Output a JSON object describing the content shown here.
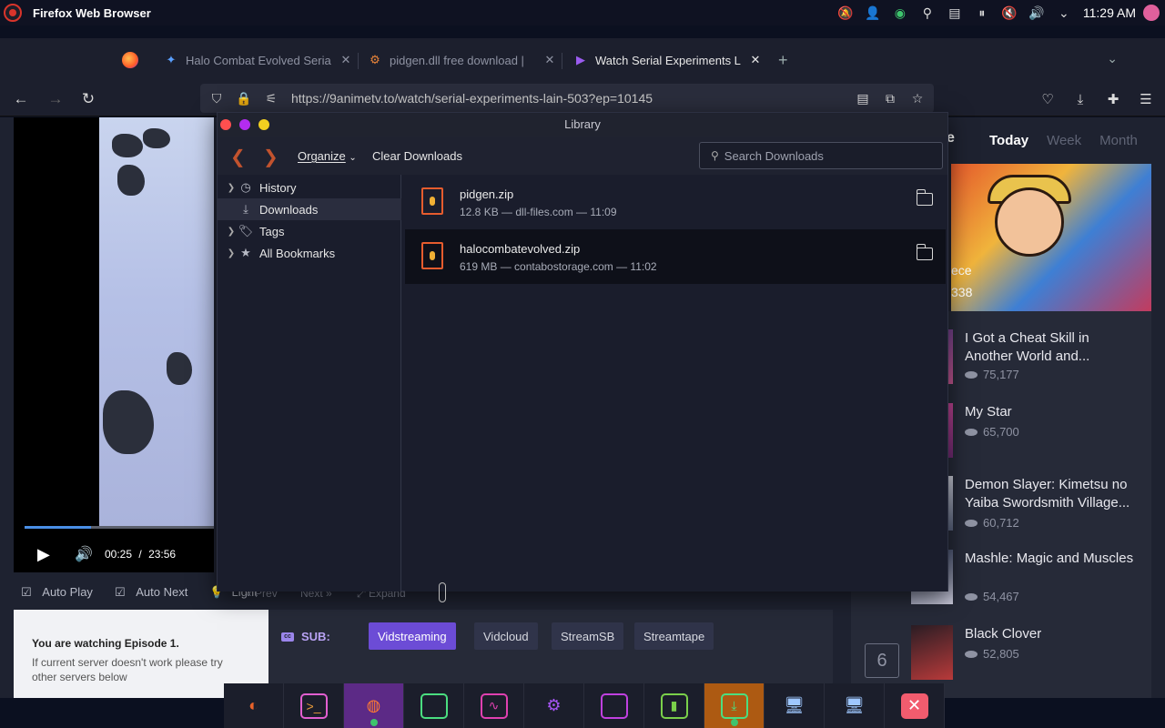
{
  "os_panel": {
    "app_title": "Firefox Web Browser",
    "clock": "11:29 AM"
  },
  "browser": {
    "tabs": [
      {
        "label": "Halo Combat Evolved Seria",
        "active": false
      },
      {
        "label": "pidgen.dll free download |",
        "active": false
      },
      {
        "label": "Watch Serial Experiments L",
        "active": true
      }
    ],
    "url": "https://9animetv.to/watch/serial-experiments-lain-503?ep=10145"
  },
  "player": {
    "current_time": "00:25",
    "separator": "/",
    "duration": "23:56",
    "progress": 0.35,
    "controls": {
      "auto_play": "Auto Play",
      "auto_next": "Auto Next",
      "light": "Light",
      "prev": "Prev",
      "next": "Next",
      "expand": "Expand"
    }
  },
  "watching": {
    "line1_prefix": "You are watching ",
    "line1_episode": "Episode 1.",
    "line2": "If current server doesn't work please try other servers below"
  },
  "servers": {
    "sub_label": "SUB:",
    "list": [
      "Vidstreaming",
      "Vidcloud",
      "StreamSB",
      "Streamtape"
    ],
    "active_index": 0
  },
  "ranking": {
    "title_partial": "e",
    "tabs": [
      "Today",
      "Week",
      "Month"
    ],
    "active_tab": "Today",
    "hero_caption": "ece",
    "hero_views": "338",
    "items": [
      {
        "name": "I Got a Cheat Skill in Another World and...",
        "views": "75,177"
      },
      {
        "name": "My Star",
        "views": "65,700"
      },
      {
        "name": "Demon Slayer: Kimetsu no Yaiba Swordsmith Village...",
        "views": "60,712"
      },
      {
        "name": "Mashle: Magic and Muscles",
        "views": "54,467"
      },
      {
        "name": "Black Clover",
        "views": "52,805",
        "rank": "6"
      }
    ]
  },
  "library": {
    "title": "Library",
    "organize": "Organize",
    "clear_downloads": "Clear Downloads",
    "search_placeholder": "Search Downloads",
    "sidebar": [
      "History",
      "Downloads",
      "Tags",
      "All Bookmarks"
    ],
    "selected": "Downloads",
    "downloads": [
      {
        "name": "pidgen.zip",
        "meta": "12.8 KB — dll-files.com — 11:09"
      },
      {
        "name": "halocombatevolved.zip",
        "meta": "619 MB — contabostorage.com — 11:02"
      }
    ]
  },
  "colors": {
    "accent_purple": "#6c4cd6",
    "firefox_orange": "#e65c2e",
    "dock_highlight": "#5c2a86"
  }
}
